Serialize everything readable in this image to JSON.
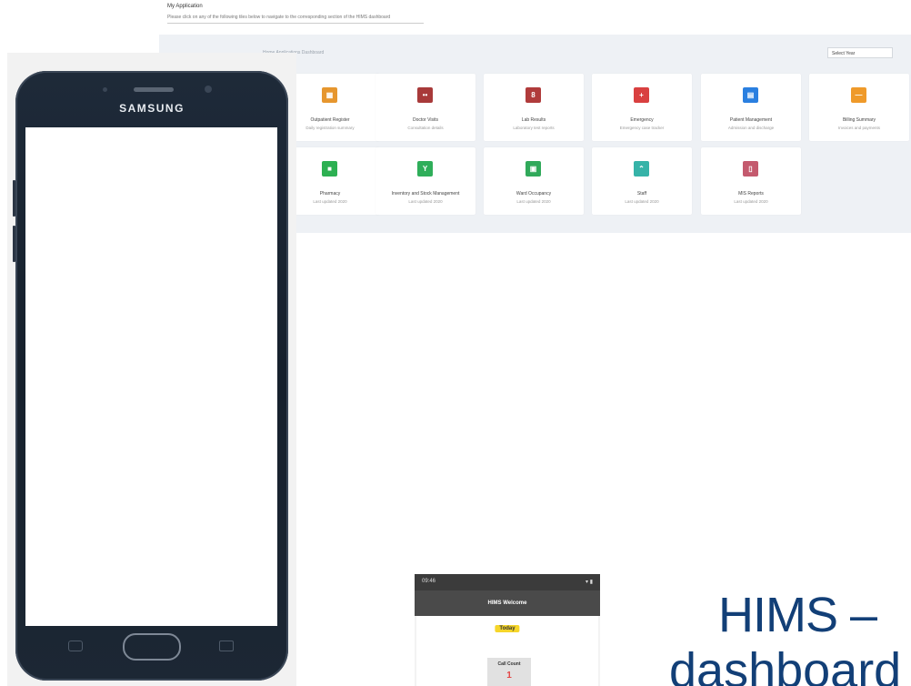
{
  "page": {
    "title": "My Application",
    "subtitle": "Please click on any of the following tiles below to navigate to the corresponding section of the HIMS dashboard"
  },
  "panel": {
    "breadcrumb": "Home  Applications  Dashboard",
    "select_value": "Select Year",
    "tiles": [
      {
        "name": "Outpatient Register",
        "sub": "Daily registration summary",
        "color": "#e6962e",
        "glyph": "▦",
        "icon": "register-icon"
      },
      {
        "name": "Doctor Visits",
        "sub": "Consultation details",
        "color": "#a83a3a",
        "glyph": "••",
        "icon": "doctor-icon"
      },
      {
        "name": "Lab Results",
        "sub": "Laboratory test reports",
        "color": "#b03b3b",
        "glyph": "8",
        "icon": "lab-icon"
      },
      {
        "name": "Emergency",
        "sub": "Emergency case tracker",
        "color": "#d94040",
        "glyph": "+",
        "icon": "emergency-icon"
      },
      {
        "name": "Patient Management",
        "sub": "Admission and discharge",
        "color": "#2a7fe0",
        "glyph": "▤",
        "icon": "patient-icon"
      },
      {
        "name": "Billing Summary",
        "sub": "Invoices and payments",
        "color": "#ef9a2a",
        "glyph": "—",
        "icon": "billing-icon"
      },
      {
        "name": "Pharmacy",
        "sub": "Last updated 2020",
        "color": "#2db052",
        "glyph": "■",
        "icon": "pharmacy-icon"
      },
      {
        "name": "Inventory and Stock Management",
        "sub": "Last updated 2020",
        "color": "#2fae5a",
        "glyph": "Y",
        "icon": "inventory-icon"
      },
      {
        "name": "Ward Occupancy",
        "sub": "Last updated 2020",
        "color": "#30a95a",
        "glyph": "▣",
        "icon": "ward-icon"
      },
      {
        "name": "Staff",
        "sub": "Last updated 2020",
        "color": "#36b3a8",
        "glyph": "⌃",
        "icon": "staff-icon"
      },
      {
        "name": "MIS Reports",
        "sub": "Last updated 2020",
        "color": "#c45a6e",
        "glyph": "▯",
        "icon": "reports-icon"
      }
    ]
  },
  "phone": {
    "brand": "SAMSUNG"
  },
  "mini_app": {
    "time": "09:46",
    "signal": "▾ ▮",
    "app_title": "HIMS Welcome",
    "badge": "Today",
    "count_label": "Call Count",
    "count_value": "1"
  },
  "headline": {
    "line1": "HIMS –",
    "line2": "dashboard"
  },
  "colors": {
    "headline": "#123f77",
    "panel_bg": "#eef1f5"
  }
}
